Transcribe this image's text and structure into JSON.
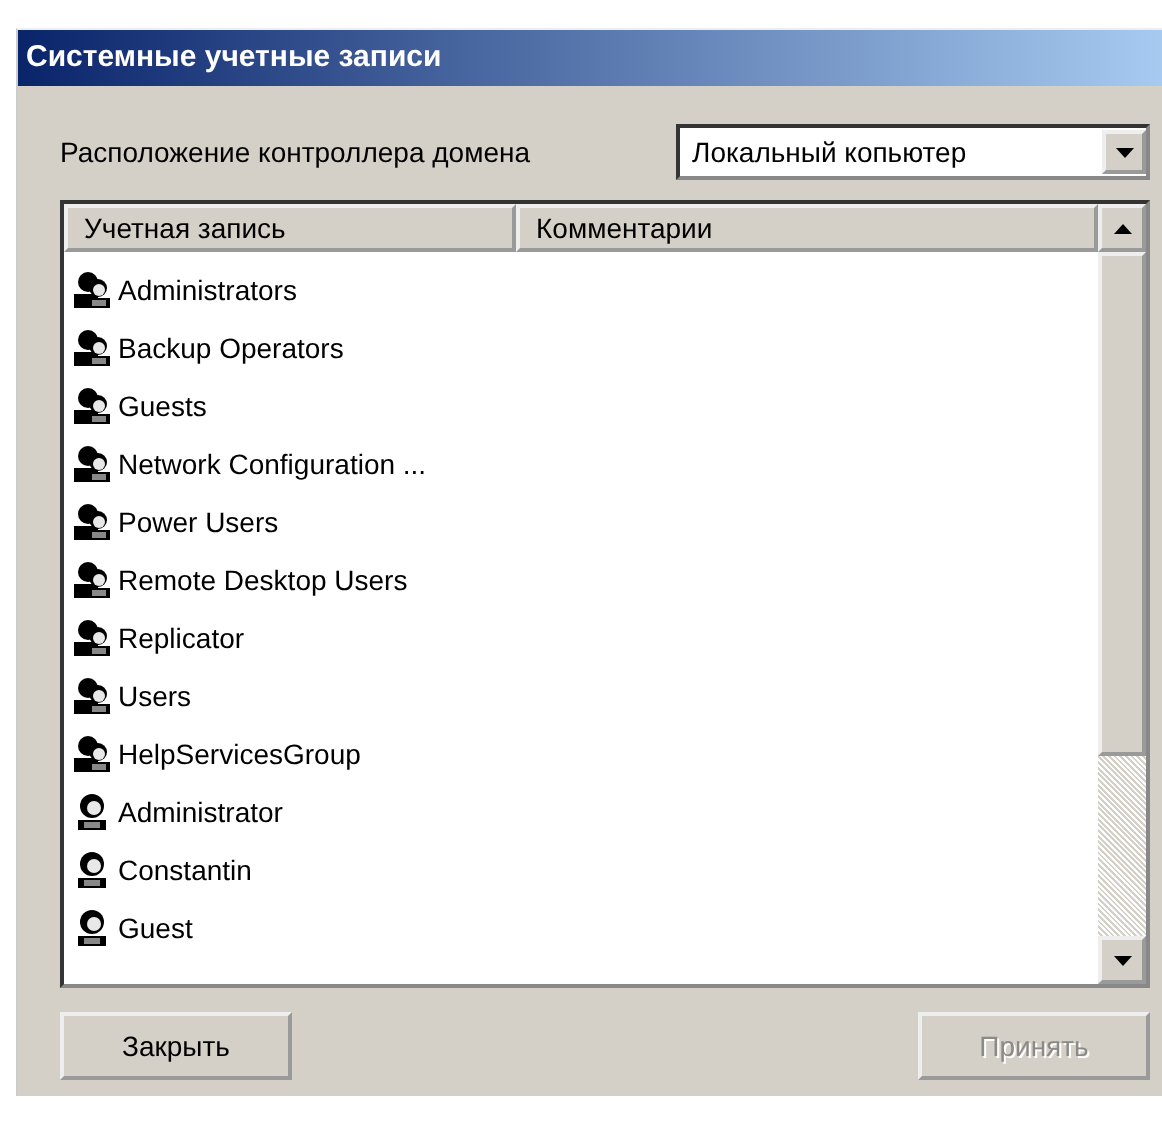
{
  "window": {
    "title": "Системные учетные записи"
  },
  "domain": {
    "label": "Расположение контроллера домена",
    "value": "Локальный копьютер"
  },
  "table": {
    "columns": [
      "Учетная запись",
      "Комментарии"
    ],
    "rows": [
      {
        "kind": "group",
        "name": "Administrators"
      },
      {
        "kind": "group",
        "name": "Backup Operators"
      },
      {
        "kind": "group",
        "name": "Guests"
      },
      {
        "kind": "group",
        "name": "Network Configuration ..."
      },
      {
        "kind": "group",
        "name": "Power Users"
      },
      {
        "kind": "group",
        "name": "Remote Desktop Users"
      },
      {
        "kind": "group",
        "name": "Replicator"
      },
      {
        "kind": "group",
        "name": "Users"
      },
      {
        "kind": "group",
        "name": "HelpServicesGroup"
      },
      {
        "kind": "user",
        "name": "Administrator"
      },
      {
        "kind": "user",
        "name": "Constantin"
      },
      {
        "kind": "user",
        "name": "Guest"
      }
    ]
  },
  "buttons": [
    {
      "label": "Закрыть",
      "disabled": false
    },
    {
      "label": "Принять",
      "disabled": true
    }
  ]
}
